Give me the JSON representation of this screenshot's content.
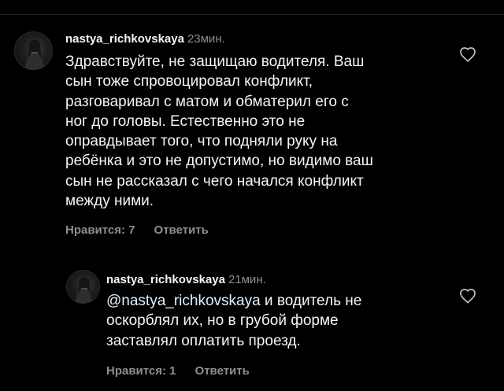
{
  "comment": {
    "username": "nastya_richkovskaya",
    "time": "23мин.",
    "lines": [
      "Здравствуйте, не защищаю водителя. Ваш",
      "сын тоже спровоцировал конфликт,",
      "разговаривал с матом и обматерил его с",
      "ног до головы. Естественно это не",
      "оправдывает того, что подняли руку на",
      "ребёнка и это не допустимо, но видимо ваш",
      "сын не рассказал с чего начался конфликт",
      "между ними."
    ],
    "likes_label": "Нравится: 7",
    "reply_label": "Ответить",
    "avatar_icon": "avatar-photo",
    "like_icon": "heart-outline-icon"
  },
  "reply": {
    "username": "nastya_richkovskaya",
    "time": "21мин.",
    "mention": "@nastya_richkovskaya",
    "first_line_rest": " и водитель не",
    "lines": [
      "оскорблял их, но в грубой форме",
      "заставлял оплатить проезд."
    ],
    "likes_label": "Нравится: 1",
    "reply_label": "Ответить",
    "avatar_icon": "avatar-photo",
    "like_icon": "heart-outline-icon"
  },
  "colors": {
    "background": "#000000",
    "text_primary": "#f5f5f5",
    "text_secondary": "#8e8e8e",
    "mention": "#e0f1ff"
  }
}
